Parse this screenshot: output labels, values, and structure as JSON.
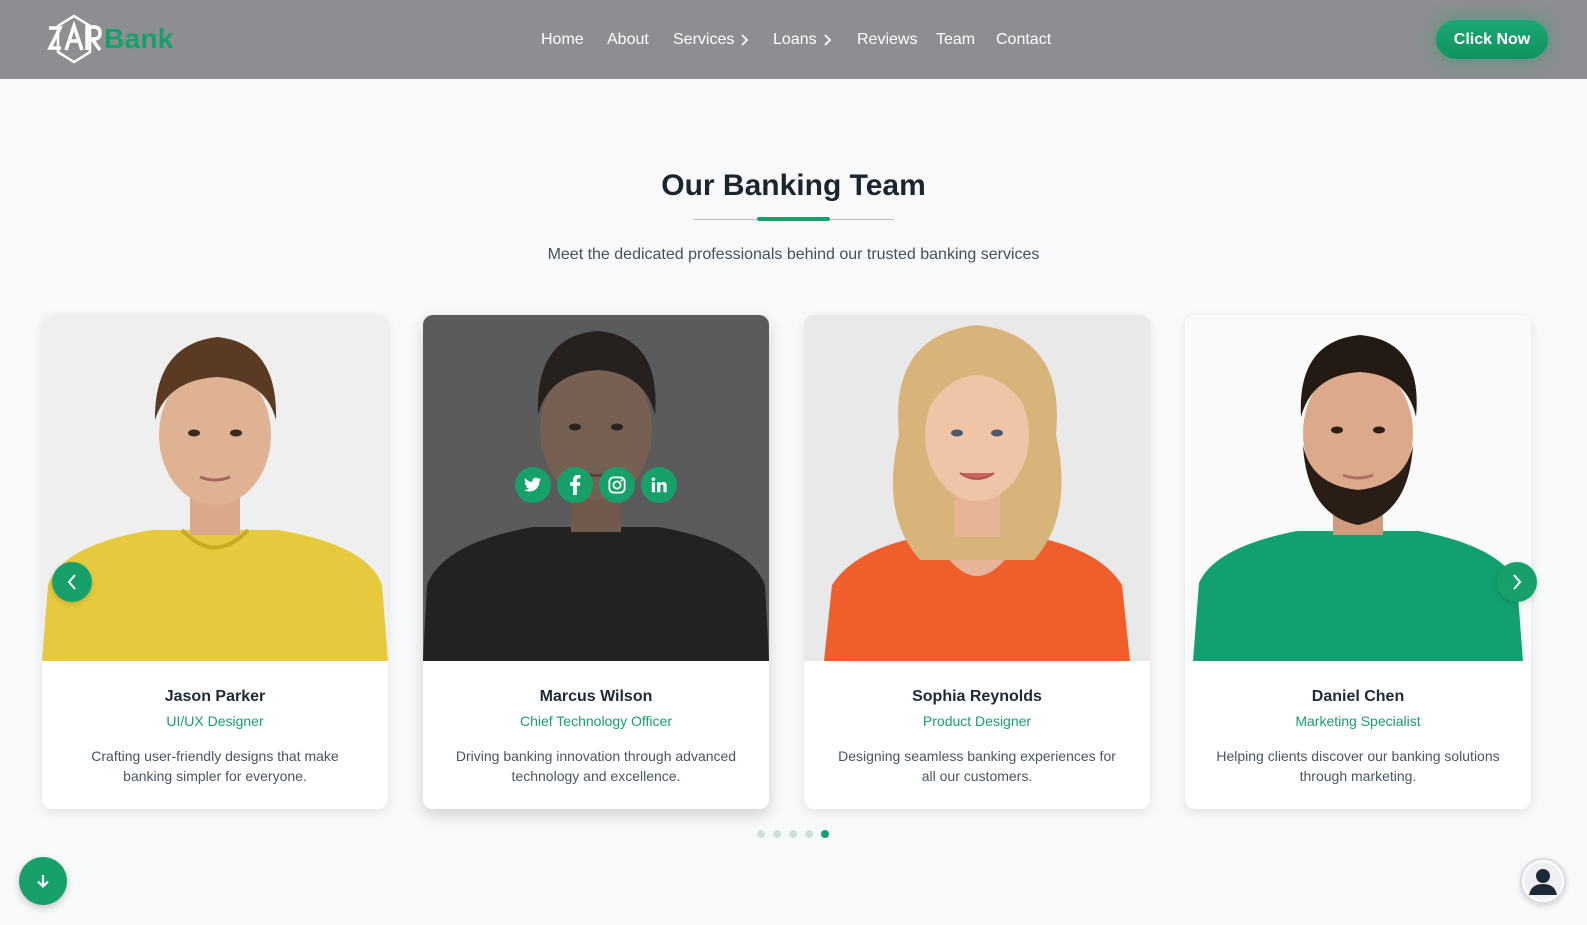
{
  "brand": {
    "logo_mark": "ZAR",
    "name": "Bank",
    "color": "#17a06a"
  },
  "nav": {
    "items": [
      {
        "label": "Home",
        "has_chevron": false
      },
      {
        "label": "About",
        "has_chevron": false
      },
      {
        "label": "Services",
        "has_chevron": true
      },
      {
        "label": "Loans",
        "has_chevron": true
      },
      {
        "label": "Reviews",
        "has_chevron": false
      },
      {
        "label": "Team",
        "has_chevron": false
      },
      {
        "label": "Contact",
        "has_chevron": false
      }
    ],
    "cta_label": "Click Now"
  },
  "section": {
    "title": "Our Banking Team",
    "subtitle": "Meet the dedicated professionals behind our trusted banking services"
  },
  "team": [
    {
      "name": "Jason Parker",
      "role": "UI/UX Designer",
      "desc": "Crafting user-friendly designs that make banking simpler for everyone.",
      "shirt_color": "#e8c93a"
    },
    {
      "name": "Marcus Wilson",
      "role": "Chief Technology Officer",
      "desc": "Driving banking innovation through advanced technology and excellence.",
      "shirt_color": "#1b1b1b",
      "socials": [
        "twitter-icon",
        "facebook-icon",
        "instagram-icon",
        "linkedin-icon"
      ]
    },
    {
      "name": "Sophia Reynolds",
      "role": "Product Designer",
      "desc": "Designing seamless banking experiences for all our customers.",
      "shirt_color": "#f0602a"
    },
    {
      "name": "Daniel Chen",
      "role": "Marketing Specialist",
      "desc": "Helping clients discover our banking solutions through marketing.",
      "shirt_color": "#12a06e"
    }
  ],
  "carousel": {
    "total_dots": 5,
    "active_dot": 5
  },
  "icons": {
    "prev": "chevron-left-icon",
    "next": "chevron-right-icon",
    "scroll": "arrow-down-icon",
    "chat": "user-avatar-icon"
  }
}
